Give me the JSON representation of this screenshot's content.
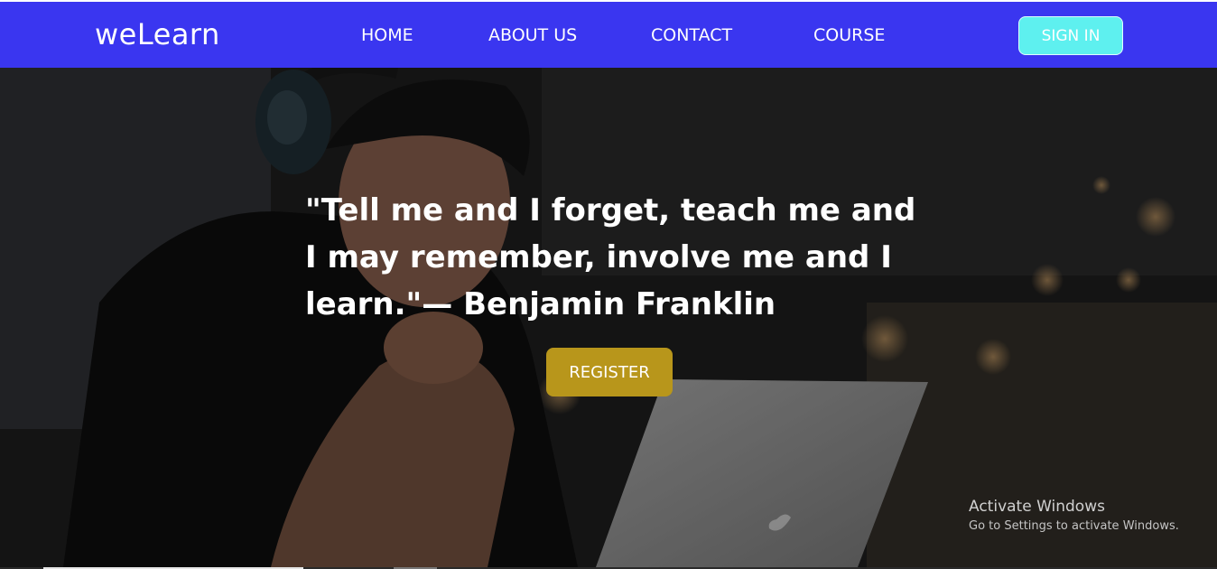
{
  "header": {
    "logo": "weLearn",
    "nav": [
      {
        "label": "HOME"
      },
      {
        "label": "ABOUT US"
      },
      {
        "label": "CONTACT"
      },
      {
        "label": "COURSE"
      }
    ],
    "signin_label": "SIGN IN"
  },
  "hero": {
    "quote": "\"Tell me and I forget, teach me and I may remember, involve me and I learn.\"— Benjamin Franklin",
    "register_label": "REGISTER"
  },
  "watermark": {
    "title": "Activate Windows",
    "subtitle": "Go to Settings to activate Windows."
  },
  "colors": {
    "nav_bg": "#3a36f0",
    "signin_bg": "#5ef0ef",
    "register_bg": "#b8961b"
  }
}
